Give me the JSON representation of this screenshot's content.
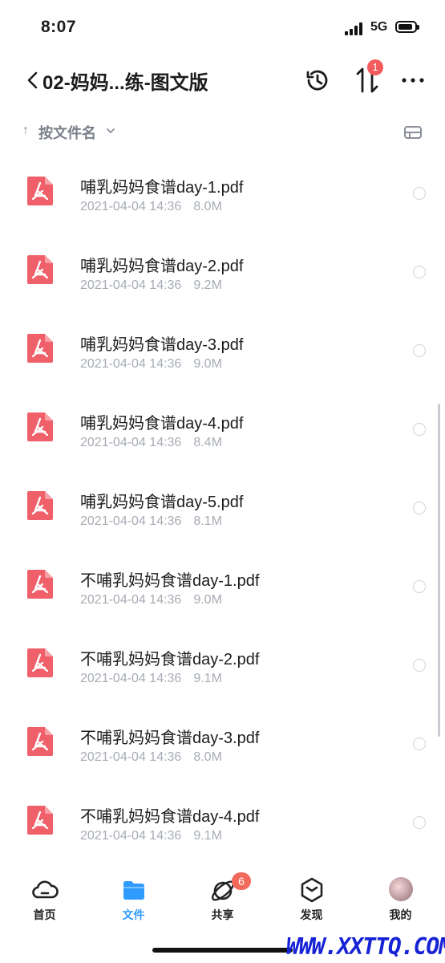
{
  "status_bar": {
    "time": "8:07",
    "network": "5G"
  },
  "header": {
    "title": "02-妈妈...练-图文版",
    "transfer_badge": "1"
  },
  "sort": {
    "arrow": "↑",
    "label": "按文件名"
  },
  "files": [
    {
      "name": "哺乳妈妈食谱day-1.pdf",
      "date": "2021-04-04 14:36",
      "size": "8.0M"
    },
    {
      "name": "哺乳妈妈食谱day-2.pdf",
      "date": "2021-04-04 14:36",
      "size": "9.2M"
    },
    {
      "name": "哺乳妈妈食谱day-3.pdf",
      "date": "2021-04-04 14:36",
      "size": "9.0M"
    },
    {
      "name": "哺乳妈妈食谱day-4.pdf",
      "date": "2021-04-04 14:36",
      "size": "8.4M"
    },
    {
      "name": "哺乳妈妈食谱day-5.pdf",
      "date": "2021-04-04 14:36",
      "size": "8.1M"
    },
    {
      "name": "不哺乳妈妈食谱day-1.pdf",
      "date": "2021-04-04 14:36",
      "size": "9.0M"
    },
    {
      "name": "不哺乳妈妈食谱day-2.pdf",
      "date": "2021-04-04 14:36",
      "size": "9.1M"
    },
    {
      "name": "不哺乳妈妈食谱day-3.pdf",
      "date": "2021-04-04 14:36",
      "size": "8.0M"
    },
    {
      "name": "不哺乳妈妈食谱day-4.pdf",
      "date": "2021-04-04 14:36",
      "size": "9.1M"
    }
  ],
  "tabs": [
    {
      "label": "首页",
      "icon": "cloud-icon"
    },
    {
      "label": "文件",
      "icon": "folder-icon"
    },
    {
      "label": "共享",
      "icon": "share-orbit-icon"
    },
    {
      "label": "发现",
      "icon": "discover-cube-icon"
    },
    {
      "label": "我的",
      "icon": "avatar"
    }
  ],
  "share_badge": "6",
  "watermark": "WWW.XXTTQ.COM",
  "colors": {
    "accent": "#2f9bff",
    "pdf_red": "#f0606a",
    "badge_red": "#f25b5b",
    "meta_gray": "#a7acb4"
  }
}
